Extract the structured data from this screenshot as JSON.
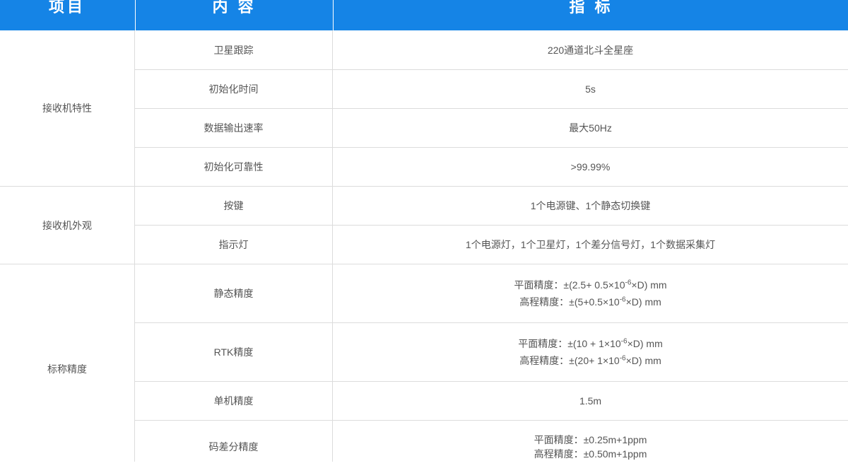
{
  "header": {
    "col1": "项目",
    "col2": "内 容",
    "col3": "指 标"
  },
  "groups": [
    {
      "name": "接收机特性"
    },
    {
      "name": "接收机外观"
    },
    {
      "name": "标称精度"
    }
  ],
  "rows": [
    {
      "content": "卫星跟踪",
      "value": "220通道北斗全星座"
    },
    {
      "content": "初始化时间",
      "value": "5s"
    },
    {
      "content": "数据输出速率",
      "value": "最大50Hz"
    },
    {
      "content": "初始化可靠性",
      "value": ">99.99%"
    },
    {
      "content": "按键",
      "value": "1个电源键、1个静态切换键"
    },
    {
      "content": "指示灯",
      "value": "1个电源灯，1个卫星灯，1个差分信号灯，1个数据采集灯"
    },
    {
      "content": "静态精度",
      "line1_pre": "平面精度：±(2.5+ 0.5×10",
      "line1_sup": "-6",
      "line1_post": "×D) mm",
      "line2_pre": "高程精度：±(5+0.5×10",
      "line2_sup": "-6",
      "line2_post": "×D) mm"
    },
    {
      "content": "RTK精度",
      "line1_pre": "平面精度：±(10 + 1×10",
      "line1_sup": "-6",
      "line1_post": "×D) mm",
      "line2_pre": "高程精度：±(20+ 1×10",
      "line2_sup": "-6",
      "line2_post": "×D) mm"
    },
    {
      "content": "单机精度",
      "value": "1.5m"
    },
    {
      "content": "码差分精度",
      "line1": "平面精度：±0.25m+1ppm",
      "line2": "高程精度：±0.50m+1ppm"
    }
  ]
}
